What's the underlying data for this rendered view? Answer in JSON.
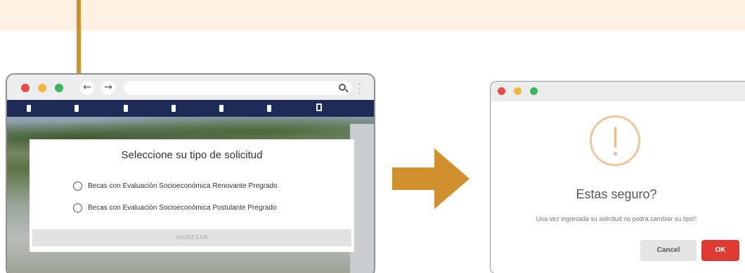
{
  "colors": {
    "accent_orange": "#d0902d",
    "band_background": "#fdf1e3",
    "site_nav": "#1f2b57",
    "dot_red": "#e94b4b",
    "dot_yellow": "#f4b63a",
    "dot_green": "#3cb45d",
    "ok_button": "#df3a32",
    "warning_ring": "#f1c69c"
  },
  "icons": {
    "back": "arrow-left-icon",
    "forward": "arrow-right-icon",
    "search": "search-icon",
    "menu": "vertical-dots-icon",
    "warning": "exclamation-circle-icon",
    "transition": "big-right-arrow-icon"
  },
  "browser": {
    "back_glyph": "←",
    "forward_glyph": "→"
  },
  "solicitud_modal": {
    "title": "Seleccione su tipo de solicitud",
    "options": [
      "Becas con Evaluación Socioeconómica Renovante Pregrado",
      "Becas con Evaluación Socioeconómica Postulante Pregrado"
    ],
    "submit_label": "INGRESAR"
  },
  "confirm_dialog": {
    "title": "Estas seguro?",
    "message": "Una vez ingresada su solicitud no podra cambiar su tipo!!",
    "cancel_label": "Cancel",
    "ok_label": "OK"
  }
}
